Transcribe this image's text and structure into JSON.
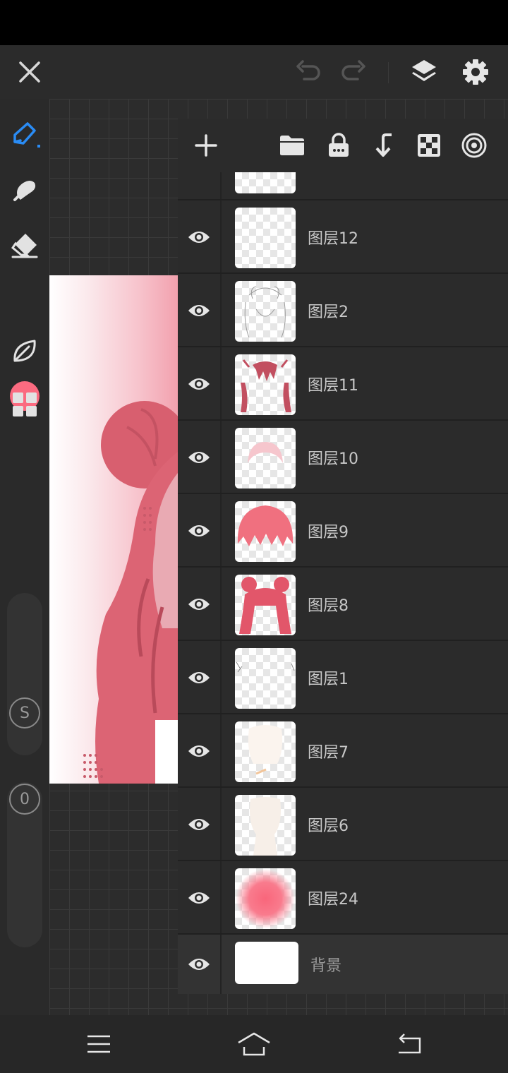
{
  "app": {
    "accent_color": "#2a8cf5",
    "brush_color": "#fb6b80",
    "icons": {
      "close": "close-icon",
      "undo": "undo-icon",
      "redo": "redo-icon",
      "layers": "layers-icon",
      "settings": "gear-icon",
      "pen": "pen-icon",
      "smudge": "smudge-icon",
      "eraser": "eraser-icon",
      "leaf": "leaf-icon",
      "grid": "grid-icon"
    }
  },
  "sliders": {
    "size_label": "S",
    "opacity_label": "0"
  },
  "layers_panel": {
    "toolbar_icons": [
      "add-icon",
      "folder-icon",
      "lock-icon",
      "merge-down-icon",
      "checker-icon",
      "target-icon"
    ],
    "layers": [
      {
        "name": "图层12",
        "visible": true
      },
      {
        "name": "图层2",
        "visible": true
      },
      {
        "name": "图层11",
        "visible": true
      },
      {
        "name": "图层10",
        "visible": true
      },
      {
        "name": "图层9",
        "visible": true
      },
      {
        "name": "图层8",
        "visible": true
      },
      {
        "name": "图层1",
        "visible": true
      },
      {
        "name": "图层7",
        "visible": true
      },
      {
        "name": "图层6",
        "visible": true
      },
      {
        "name": "图层24",
        "visible": true
      },
      {
        "name": "背景",
        "visible": true
      }
    ]
  },
  "nav_bar": {
    "icons": [
      "menu-icon",
      "home-icon",
      "back-icon"
    ]
  }
}
